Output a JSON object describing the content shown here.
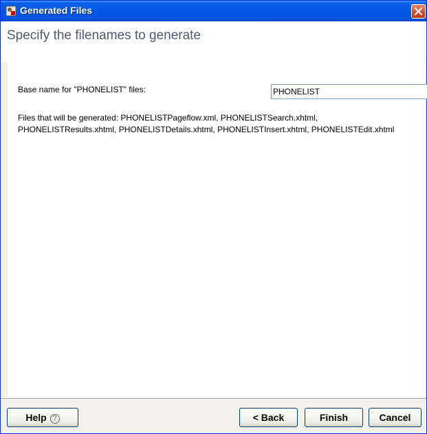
{
  "window": {
    "title": "Generated Files"
  },
  "heading": "Specify the filenames to generate",
  "form": {
    "base_name_label": "Base name for \"PHONELIST\" files:",
    "base_name_value": "PHONELIST"
  },
  "files_text": "Files that will be generated: PHONELISTPageflow.xml, PHONELISTSearch.xhtml, PHONELISTResults.xhtml, PHONELISTDetails.xhtml, PHONELISTInsert.xhtml, PHONELISTEdit.xhtml",
  "buttons": {
    "help": "Help",
    "help_glyph": "?",
    "back": "< Back",
    "finish": "Finish",
    "cancel": "Cancel"
  },
  "icons": {
    "window": "app-icon",
    "close": "close-icon",
    "help": "help-icon"
  }
}
